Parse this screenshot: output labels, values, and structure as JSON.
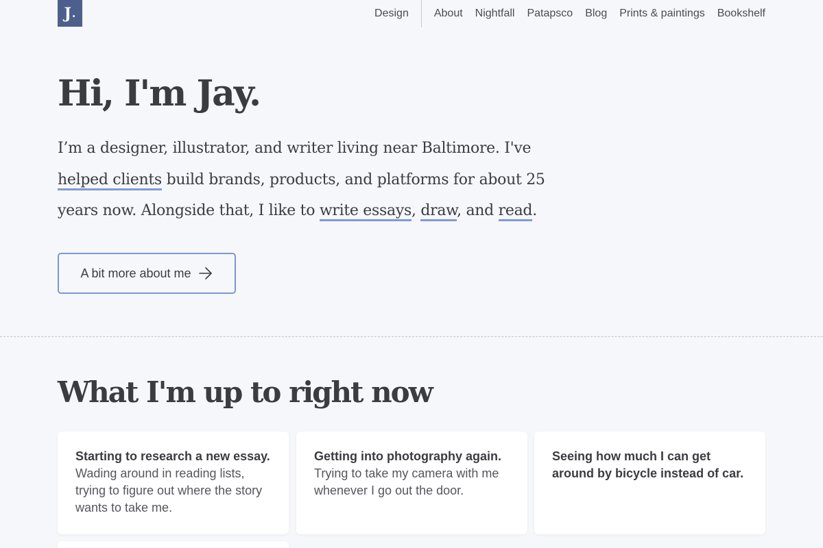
{
  "logo": {
    "text": "J",
    "dot": "."
  },
  "nav": {
    "primary": "Design",
    "items": [
      "About",
      "Nightfall",
      "Patapsco",
      "Blog",
      "Prints & paintings",
      "Bookshelf"
    ]
  },
  "hero": {
    "title": "Hi, I'm Jay.",
    "intro_1": "I’m a designer, illustrator, and writer living near Baltimore. I've ",
    "link_clients": "helped clients",
    "intro_2": " build brands, products, and platforms for about 25 years now. Alongside that, I like to ",
    "link_essays": "write essays",
    "sep_1": ", ",
    "link_draw": "draw",
    "sep_2": ", and ",
    "link_read": "read",
    "end": ".",
    "cta_label": "A bit more about me",
    "cta_icon": "arrow-right-icon"
  },
  "now": {
    "title": "What I'm up to right now",
    "cards": [
      {
        "heading": "Starting to research a new essay.",
        "body": " Wading around in reading lists, trying to figure out where the story wants to take me."
      },
      {
        "heading": "Getting into photography again.",
        "body": " Trying to take my camera with me whenever I go out the door."
      },
      {
        "heading": "Seeing how much I can get around by bicycle instead of car.",
        "body": ""
      }
    ]
  },
  "colors": {
    "background": "#f6f7fb",
    "logo_bg": "#4d5f8c",
    "link_underline": "#7f9ad4",
    "text": "#3b3c40"
  }
}
